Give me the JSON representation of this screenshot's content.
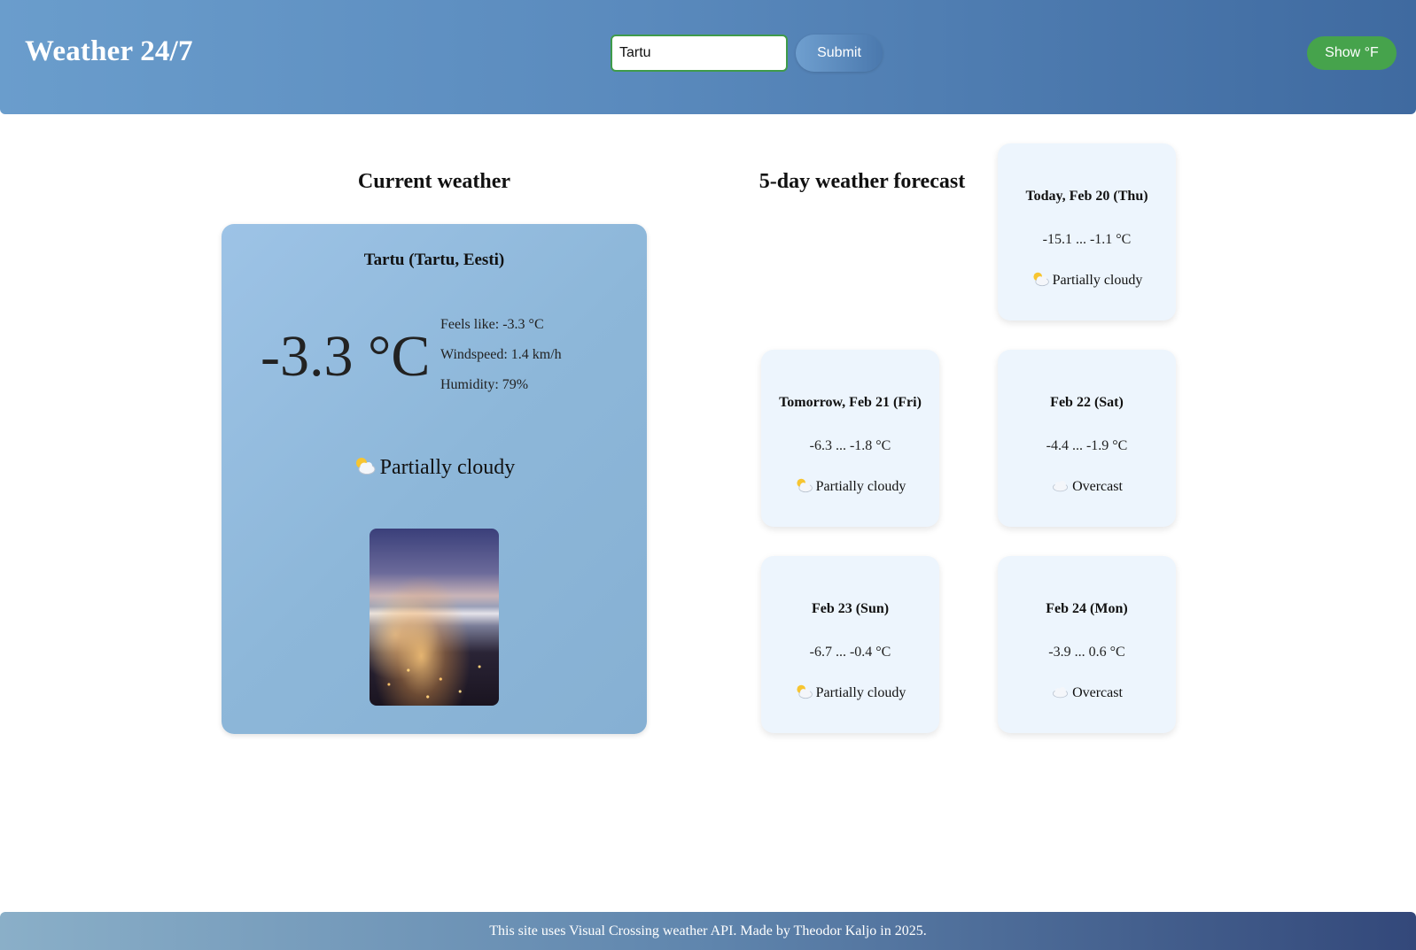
{
  "header": {
    "title": "Weather 24/7",
    "search_value": "Tartu",
    "submit_label": "Submit",
    "unit_toggle_label": "Show °F"
  },
  "current": {
    "section_title": "Current weather",
    "location": "Tartu (Tartu, Eesti)",
    "temperature": "-3.3 °C",
    "feels_like": "Feels like: -3.3 °C",
    "windspeed": "Windspeed: 1.4 km/h",
    "humidity": "Humidity: 79%",
    "condition": "Partially cloudy",
    "condition_icon": "partly-cloudy-icon",
    "photo": "night-clouds-city-lights-photo"
  },
  "forecast": {
    "section_title": "5-day weather forecast",
    "days": [
      {
        "date": "Today, Feb 20 (Thu)",
        "range": "-15.1 ... -1.1 °C",
        "condition": "Partially cloudy",
        "icon": "partly-cloudy-icon"
      },
      {
        "date": "Tomorrow, Feb 21 (Fri)",
        "range": "-6.3 ... -1.8 °C",
        "condition": "Partially cloudy",
        "icon": "partly-cloudy-icon"
      },
      {
        "date": "Feb 22 (Sat)",
        "range": "-4.4 ... -1.9 °C",
        "condition": "Overcast",
        "icon": "cloud-icon"
      },
      {
        "date": "Feb 23 (Sun)",
        "range": "-6.7 ... -0.4 °C",
        "condition": "Partially cloudy",
        "icon": "partly-cloudy-icon"
      },
      {
        "date": "Feb 24 (Mon)",
        "range": "-3.9 ... 0.6 °C",
        "condition": "Overcast",
        "icon": "cloud-icon"
      }
    ]
  },
  "footer": {
    "text": "This site uses Visual Crossing weather API. Made by Theodor Kaljo in 2025."
  },
  "colors": {
    "header_start": "#6a9dcc",
    "header_end": "#3f6aa0",
    "unit_toggle": "#46a34c",
    "forecast_card": "#edf5fd",
    "current_card": "#8db7d9"
  }
}
